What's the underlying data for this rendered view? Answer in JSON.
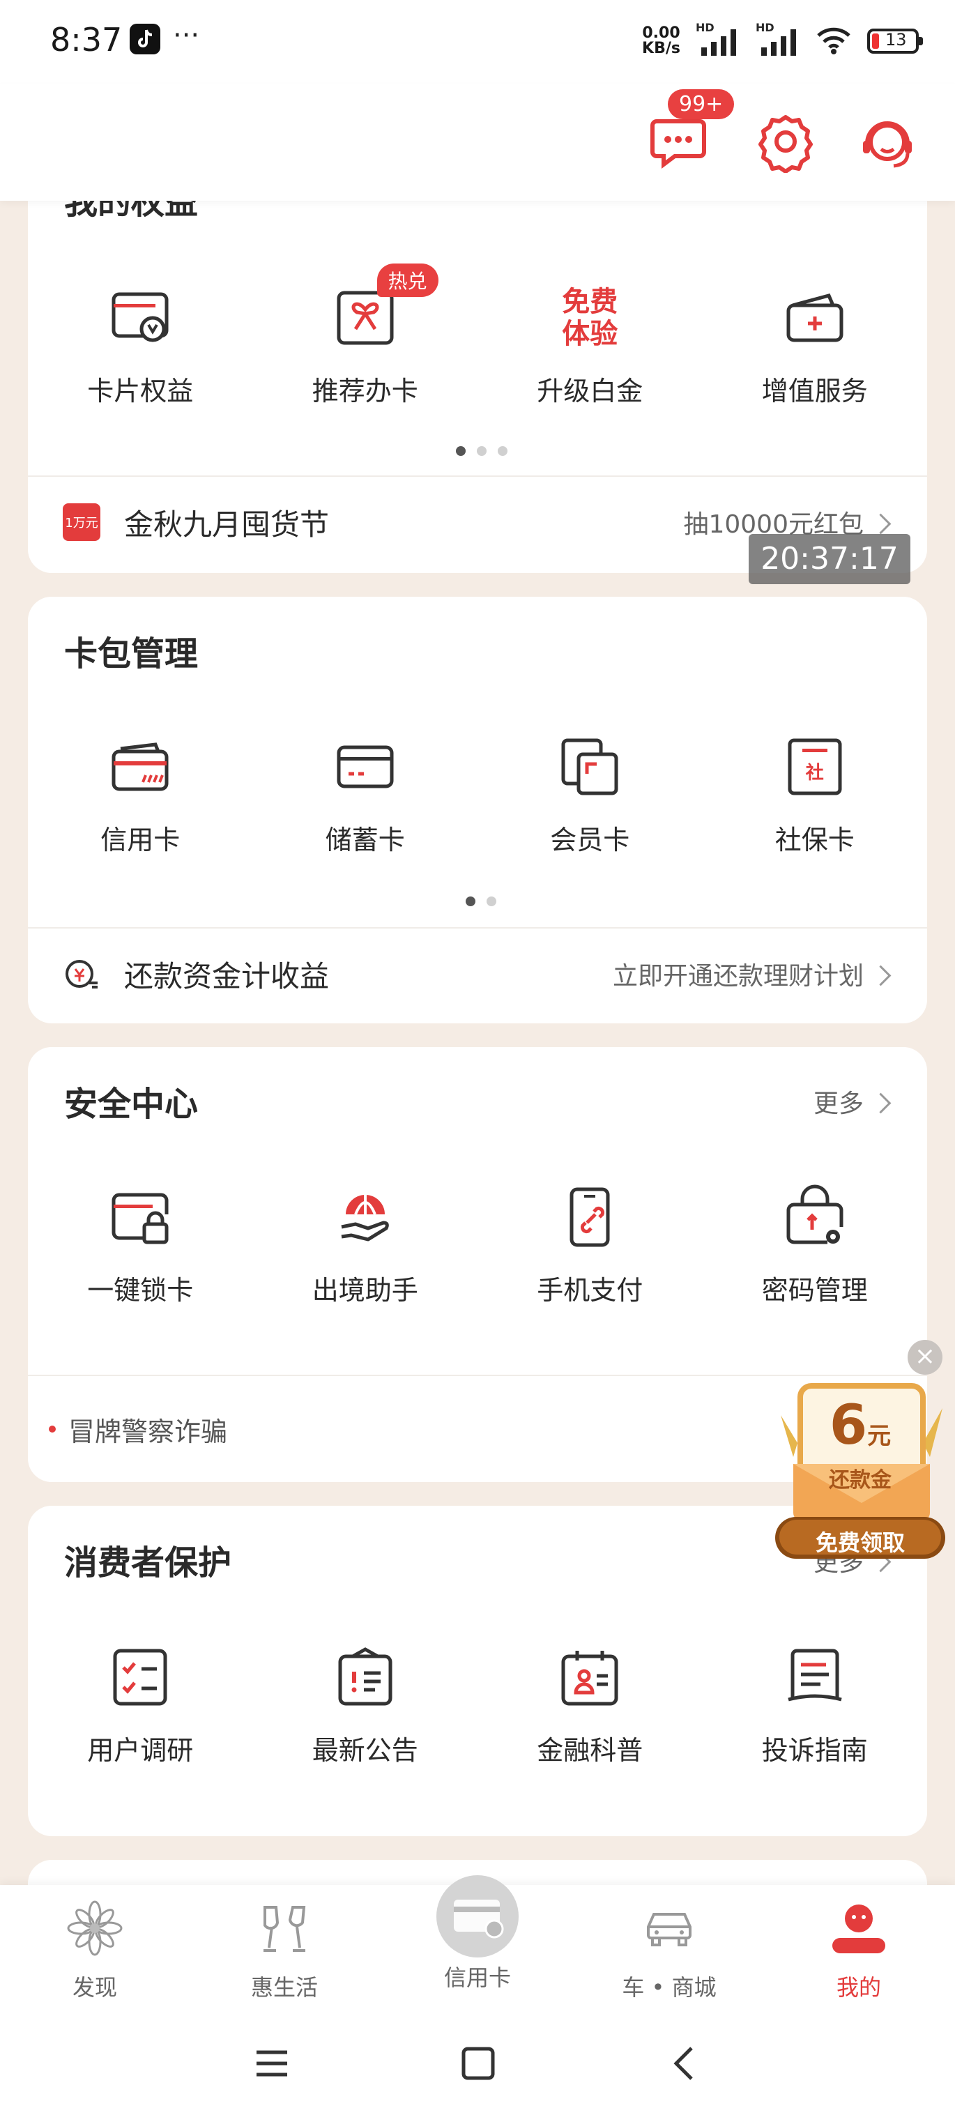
{
  "status_bar": {
    "time": "8:37",
    "more": "···",
    "net_speed_value": "0.00",
    "net_speed_unit": "KB/s",
    "signal_label_1": "HD",
    "signal_label_2": "HD",
    "battery": "13"
  },
  "header": {
    "message_badge": "99+",
    "icons": [
      "message-icon",
      "settings-icon",
      "customer-service-icon"
    ]
  },
  "rights_card": {
    "title": "我的权益",
    "items": [
      {
        "label": "卡片权益",
        "icon": "card-rights-icon"
      },
      {
        "label": "推荐办卡",
        "icon": "gift-card-icon",
        "badge": "热兑"
      },
      {
        "label": "升级白金",
        "icon": "free-trial-icon",
        "icon_text_1": "免费",
        "icon_text_2": "体验"
      },
      {
        "label": "增值服务",
        "icon": "wallet-plus-icon"
      }
    ],
    "page_dots": 3,
    "active_dot": 0,
    "promo_row": {
      "icon_text": "1万元",
      "title": "金秋九月囤货节",
      "right": "抽10000元红包"
    }
  },
  "timestamp_overlay": "20:37:17",
  "wallet_card": {
    "title": "卡包管理",
    "items": [
      {
        "label": "信用卡",
        "icon": "credit-card-icon"
      },
      {
        "label": "储蓄卡",
        "icon": "debit-card-icon"
      },
      {
        "label": "会员卡",
        "icon": "member-card-icon"
      },
      {
        "label": "社保卡",
        "icon": "social-security-card-icon",
        "icon_text": "社"
      }
    ],
    "page_dots": 2,
    "active_dot": 0,
    "row": {
      "title": "还款资金计收益",
      "right": "立即开通还款理财计划"
    }
  },
  "security_card": {
    "title": "安全中心",
    "more": "更多",
    "items": [
      {
        "label": "一键锁卡",
        "icon": "lock-card-icon"
      },
      {
        "label": "出境助手",
        "icon": "travel-globe-icon"
      },
      {
        "label": "手机支付",
        "icon": "phone-pay-icon"
      },
      {
        "label": "密码管理",
        "icon": "password-lock-icon"
      }
    ],
    "notice": "冒牌警察诈骗"
  },
  "consumer_card": {
    "title": "消费者保护",
    "more": "更多",
    "items": [
      {
        "label": "用户调研",
        "icon": "survey-icon"
      },
      {
        "label": "最新公告",
        "icon": "announcement-icon"
      },
      {
        "label": "金融科普",
        "icon": "finance-education-icon"
      },
      {
        "label": "投诉指南",
        "icon": "complaint-guide-icon"
      }
    ]
  },
  "promo_float": {
    "amount": "6",
    "unit": "元",
    "subtitle": "还款金",
    "button": "免费领取",
    "close": "×"
  },
  "bottom_nav": {
    "items": [
      {
        "label": "发现",
        "icon": "discover-icon"
      },
      {
        "label": "惠生活",
        "icon": "life-icon"
      },
      {
        "label": "信用卡",
        "icon": "credit-card-tab-icon"
      },
      {
        "label": "车 • 商城",
        "icon": "car-mall-icon"
      },
      {
        "label": "我的",
        "icon": "profile-icon"
      }
    ],
    "active_index": 4
  },
  "colors": {
    "accent": "#e33c3c",
    "background": "#f5ece4",
    "card": "#ffffff",
    "promo_gold": "#d9922e"
  }
}
